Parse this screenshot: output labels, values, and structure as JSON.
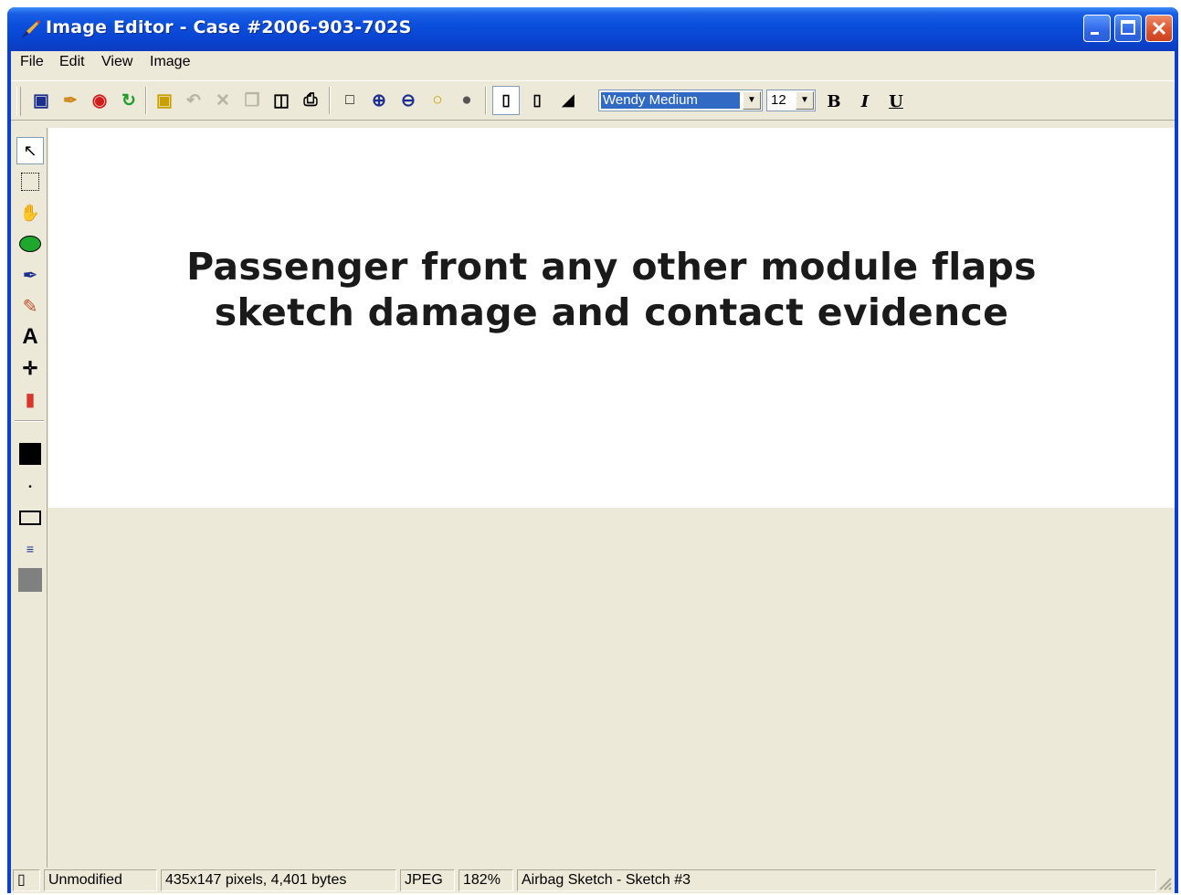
{
  "window": {
    "title": "Image Editor - Case #2006-903-702S"
  },
  "menu": [
    "File",
    "Edit",
    "View",
    "Image"
  ],
  "toolbar": {
    "font_name": "Wendy Medium",
    "font_size": "12",
    "bold_label": "B",
    "italic_label": "I",
    "underline_label": "U"
  },
  "canvas": {
    "line1": "Passenger front any other module flaps",
    "line2": "sketch damage and contact evidence"
  },
  "status": {
    "state": "Unmodified",
    "dimensions": "435x147 pixels, 4,401 bytes",
    "format": "JPEG",
    "zoom": "182%",
    "sketch": "Airbag Sketch - Sketch #3"
  },
  "colors": {
    "title_bar": "#0a4fdc",
    "foreground": "#000000",
    "fill": "#808080"
  }
}
